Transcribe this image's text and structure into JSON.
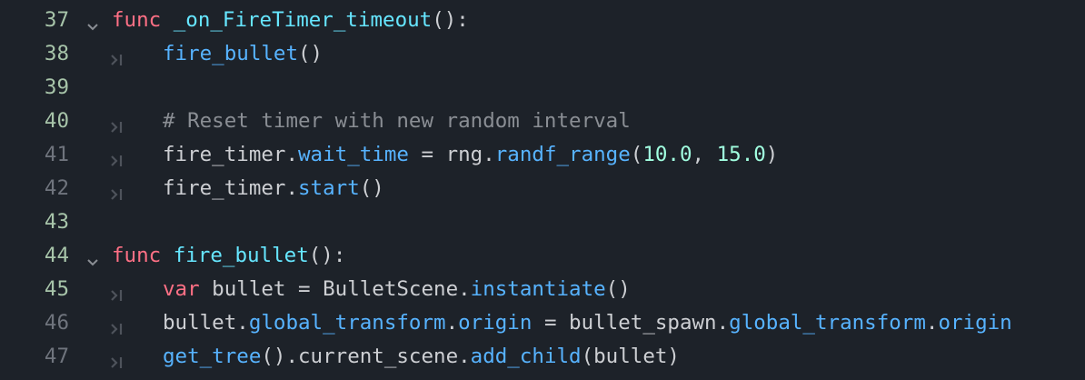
{
  "editor": {
    "language": "GDScript",
    "colors": {
      "background": "#1d2229",
      "line_number": "#6f747d",
      "line_number_highlight": "#a7c4a9",
      "keyword": "#ff7085",
      "function_name": "#66e6ff",
      "call": "#57b3ff",
      "number": "#a1ffe0",
      "comment": "#8a8e94",
      "text": "#cdcfd3"
    },
    "lines": [
      {
        "number": "37",
        "fold_icon": "chevron-down-icon",
        "tokens": [
          {
            "t": "func",
            "c": "kw"
          },
          {
            "t": " ",
            "c": "tx"
          },
          {
            "t": "_on_FireTimer_timeout",
            "c": "fn"
          },
          {
            "t": "():",
            "c": "tx"
          }
        ]
      },
      {
        "number": "38",
        "indent_icon": "tab-indent-icon",
        "tokens": [
          {
            "t": "fire_bullet",
            "c": "call"
          },
          {
            "t": "()",
            "c": "tx"
          }
        ]
      },
      {
        "number": "39",
        "tokens": []
      },
      {
        "number": "40",
        "indent_icon": "tab-indent-icon",
        "tokens": [
          {
            "t": "# Reset timer with new random interval",
            "c": "cm"
          }
        ]
      },
      {
        "number": "41",
        "indent_icon": "tab-indent-icon",
        "tokens": [
          {
            "t": "fire_timer.",
            "c": "tx"
          },
          {
            "t": "wait_time",
            "c": "call"
          },
          {
            "t": " = rng.",
            "c": "tx"
          },
          {
            "t": "randf_range",
            "c": "call"
          },
          {
            "t": "(",
            "c": "tx"
          },
          {
            "t": "10.0",
            "c": "num"
          },
          {
            "t": ", ",
            "c": "tx"
          },
          {
            "t": "15.0",
            "c": "num"
          },
          {
            "t": ")",
            "c": "tx"
          }
        ]
      },
      {
        "number": "42",
        "indent_icon": "tab-indent-icon",
        "tokens": [
          {
            "t": "fire_timer.",
            "c": "tx"
          },
          {
            "t": "start",
            "c": "call"
          },
          {
            "t": "()",
            "c": "tx"
          }
        ]
      },
      {
        "number": "43",
        "tokens": []
      },
      {
        "number": "44",
        "fold_icon": "chevron-down-icon",
        "tokens": [
          {
            "t": "func",
            "c": "kw"
          },
          {
            "t": " ",
            "c": "tx"
          },
          {
            "t": "fire_bullet",
            "c": "fn"
          },
          {
            "t": "():",
            "c": "tx"
          }
        ]
      },
      {
        "number": "45",
        "indent_icon": "tab-indent-icon",
        "tokens": [
          {
            "t": "var",
            "c": "kw"
          },
          {
            "t": " bullet = BulletScene.",
            "c": "tx"
          },
          {
            "t": "instantiate",
            "c": "call"
          },
          {
            "t": "()",
            "c": "tx"
          }
        ]
      },
      {
        "number": "46",
        "indent_icon": "tab-indent-icon",
        "tokens": [
          {
            "t": "bullet.",
            "c": "tx"
          },
          {
            "t": "global_transform",
            "c": "call"
          },
          {
            "t": ".",
            "c": "tx"
          },
          {
            "t": "origin",
            "c": "call"
          },
          {
            "t": " = bullet_spawn.",
            "c": "tx"
          },
          {
            "t": "global_transform",
            "c": "call"
          },
          {
            "t": ".",
            "c": "tx"
          },
          {
            "t": "origin",
            "c": "call"
          }
        ]
      },
      {
        "number": "47",
        "indent_icon": "tab-indent-icon",
        "tokens": [
          {
            "t": "get_tree",
            "c": "call"
          },
          {
            "t": "().current_scene.",
            "c": "tx"
          },
          {
            "t": "add_child",
            "c": "call"
          },
          {
            "t": "(bullet)",
            "c": "tx"
          }
        ]
      }
    ]
  }
}
